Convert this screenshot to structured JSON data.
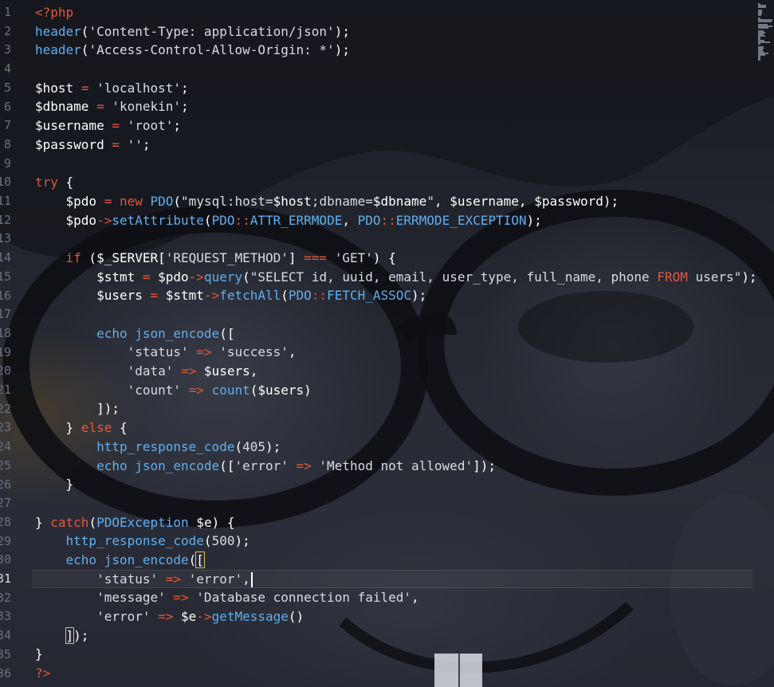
{
  "editor": {
    "active_line": 31,
    "lines": [
      {
        "n": "1",
        "tokens": [
          {
            "t": "<?php",
            "c": "tok-php"
          }
        ]
      },
      {
        "n": "2",
        "tokens": [
          {
            "t": "header",
            "c": "tok-fn"
          },
          {
            "t": "(",
            "c": "tok-punct"
          },
          {
            "t": "'Content-Type: application/json'",
            "c": "tok-str"
          },
          {
            "t": ");",
            "c": "tok-punct"
          }
        ]
      },
      {
        "n": "3",
        "tokens": [
          {
            "t": "header",
            "c": "tok-fn"
          },
          {
            "t": "(",
            "c": "tok-punct"
          },
          {
            "t": "'Access-Control-Allow-Origin: *'",
            "c": "tok-str"
          },
          {
            "t": ");",
            "c": "tok-punct"
          }
        ]
      },
      {
        "n": "4",
        "tokens": []
      },
      {
        "n": "5",
        "tokens": [
          {
            "t": "$host",
            "c": "tok-var"
          },
          {
            "t": " = ",
            "c": "tok-op"
          },
          {
            "t": "'localhost'",
            "c": "tok-str"
          },
          {
            "t": ";",
            "c": "tok-punct"
          }
        ]
      },
      {
        "n": "6",
        "tokens": [
          {
            "t": "$dbname",
            "c": "tok-var"
          },
          {
            "t": " = ",
            "c": "tok-op"
          },
          {
            "t": "'konekin'",
            "c": "tok-str"
          },
          {
            "t": ";",
            "c": "tok-punct"
          }
        ]
      },
      {
        "n": "7",
        "tokens": [
          {
            "t": "$username",
            "c": "tok-var"
          },
          {
            "t": " = ",
            "c": "tok-op"
          },
          {
            "t": "'root'",
            "c": "tok-str"
          },
          {
            "t": ";",
            "c": "tok-punct"
          }
        ]
      },
      {
        "n": "8",
        "tokens": [
          {
            "t": "$password",
            "c": "tok-var"
          },
          {
            "t": " = ",
            "c": "tok-op"
          },
          {
            "t": "''",
            "c": "tok-str"
          },
          {
            "t": ";",
            "c": "tok-punct"
          }
        ]
      },
      {
        "n": "9",
        "tokens": []
      },
      {
        "n": "10",
        "tokens": [
          {
            "t": "try",
            "c": "tok-kw"
          },
          {
            "t": " {",
            "c": "tok-punct"
          }
        ]
      },
      {
        "n": "11",
        "tokens": [
          {
            "t": "    $pdo",
            "c": "tok-var"
          },
          {
            "t": " = ",
            "c": "tok-op"
          },
          {
            "t": "new",
            "c": "tok-kw"
          },
          {
            "t": " PDO",
            "c": "tok-cls"
          },
          {
            "t": "(",
            "c": "tok-punct"
          },
          {
            "t": "\"mysql:host=",
            "c": "tok-str"
          },
          {
            "t": "$host",
            "c": "tok-var"
          },
          {
            "t": ";dbname=",
            "c": "tok-str"
          },
          {
            "t": "$dbname",
            "c": "tok-var"
          },
          {
            "t": "\"",
            "c": "tok-str"
          },
          {
            "t": ", ",
            "c": "tok-punct"
          },
          {
            "t": "$username",
            "c": "tok-var"
          },
          {
            "t": ", ",
            "c": "tok-punct"
          },
          {
            "t": "$password",
            "c": "tok-var"
          },
          {
            "t": ");",
            "c": "tok-punct"
          }
        ]
      },
      {
        "n": "12",
        "tokens": [
          {
            "t": "    $pdo",
            "c": "tok-var"
          },
          {
            "t": "->",
            "c": "tok-op"
          },
          {
            "t": "setAttribute",
            "c": "tok-fn"
          },
          {
            "t": "(",
            "c": "tok-punct"
          },
          {
            "t": "PDO",
            "c": "tok-cls"
          },
          {
            "t": "::",
            "c": "tok-op"
          },
          {
            "t": "ATTR_ERRMODE",
            "c": "tok-cls"
          },
          {
            "t": ", ",
            "c": "tok-punct"
          },
          {
            "t": "PDO",
            "c": "tok-cls"
          },
          {
            "t": "::",
            "c": "tok-op"
          },
          {
            "t": "ERRMODE_EXCEPTION",
            "c": "tok-cls"
          },
          {
            "t": ");",
            "c": "tok-punct"
          }
        ]
      },
      {
        "n": "13",
        "tokens": []
      },
      {
        "n": "14",
        "tokens": [
          {
            "t": "    if",
            "c": "tok-kw"
          },
          {
            "t": " (",
            "c": "tok-punct"
          },
          {
            "t": "$_SERVER",
            "c": "tok-var"
          },
          {
            "t": "[",
            "c": "tok-punct"
          },
          {
            "t": "'REQUEST_METHOD'",
            "c": "tok-str"
          },
          {
            "t": "] ",
            "c": "tok-punct"
          },
          {
            "t": "===",
            "c": "tok-op"
          },
          {
            "t": " 'GET'",
            "c": "tok-str"
          },
          {
            "t": ") {",
            "c": "tok-punct"
          }
        ]
      },
      {
        "n": "15",
        "tokens": [
          {
            "t": "        $stmt",
            "c": "tok-var"
          },
          {
            "t": " = ",
            "c": "tok-op"
          },
          {
            "t": "$pdo",
            "c": "tok-var"
          },
          {
            "t": "->",
            "c": "tok-op"
          },
          {
            "t": "query",
            "c": "tok-fn"
          },
          {
            "t": "(",
            "c": "tok-punct"
          },
          {
            "t": "\"SELECT id, uuid, email, user_type, full_name, phone ",
            "c": "tok-str"
          },
          {
            "t": "FROM",
            "c": "tok-kw"
          },
          {
            "t": " users\"",
            "c": "tok-str"
          },
          {
            "t": ");",
            "c": "tok-punct"
          }
        ]
      },
      {
        "n": "16",
        "tokens": [
          {
            "t": "        $users",
            "c": "tok-var"
          },
          {
            "t": " = ",
            "c": "tok-op"
          },
          {
            "t": "$stmt",
            "c": "tok-var"
          },
          {
            "t": "->",
            "c": "tok-op"
          },
          {
            "t": "fetchAll",
            "c": "tok-fn"
          },
          {
            "t": "(",
            "c": "tok-punct"
          },
          {
            "t": "PDO",
            "c": "tok-cls"
          },
          {
            "t": "::",
            "c": "tok-op"
          },
          {
            "t": "FETCH_ASSOC",
            "c": "tok-cls"
          },
          {
            "t": ");",
            "c": "tok-punct"
          }
        ]
      },
      {
        "n": "17",
        "tokens": []
      },
      {
        "n": "18",
        "tokens": [
          {
            "t": "        echo",
            "c": "tok-fn"
          },
          {
            "t": " json_encode",
            "c": "tok-fn"
          },
          {
            "t": "([",
            "c": "tok-punct"
          }
        ]
      },
      {
        "n": "19",
        "tokens": [
          {
            "t": "            'status'",
            "c": "tok-str"
          },
          {
            "t": " => ",
            "c": "tok-op"
          },
          {
            "t": "'success'",
            "c": "tok-str"
          },
          {
            "t": ",",
            "c": "tok-punct"
          }
        ]
      },
      {
        "n": "20",
        "tokens": [
          {
            "t": "            'data'",
            "c": "tok-str"
          },
          {
            "t": " => ",
            "c": "tok-op"
          },
          {
            "t": "$users",
            "c": "tok-var"
          },
          {
            "t": ",",
            "c": "tok-punct"
          }
        ]
      },
      {
        "n": "21",
        "tokens": [
          {
            "t": "            'count'",
            "c": "tok-str"
          },
          {
            "t": " => ",
            "c": "tok-op"
          },
          {
            "t": "count",
            "c": "tok-fn"
          },
          {
            "t": "(",
            "c": "tok-punct"
          },
          {
            "t": "$users",
            "c": "tok-var"
          },
          {
            "t": ")",
            "c": "tok-punct"
          }
        ]
      },
      {
        "n": "22",
        "tokens": [
          {
            "t": "        ]);",
            "c": "tok-punct"
          }
        ]
      },
      {
        "n": "23",
        "tokens": [
          {
            "t": "    }",
            "c": "tok-punct"
          },
          {
            "t": " else",
            "c": "tok-kw"
          },
          {
            "t": " {",
            "c": "tok-punct"
          }
        ]
      },
      {
        "n": "24",
        "tokens": [
          {
            "t": "        http_response_code",
            "c": "tok-fn"
          },
          {
            "t": "(",
            "c": "tok-punct"
          },
          {
            "t": "405",
            "c": "tok-str"
          },
          {
            "t": ");",
            "c": "tok-punct"
          }
        ]
      },
      {
        "n": "25",
        "tokens": [
          {
            "t": "        echo",
            "c": "tok-fn"
          },
          {
            "t": " json_encode",
            "c": "tok-fn"
          },
          {
            "t": "([",
            "c": "tok-punct"
          },
          {
            "t": "'error'",
            "c": "tok-str"
          },
          {
            "t": " => ",
            "c": "tok-op"
          },
          {
            "t": "'Method not allowed'",
            "c": "tok-str"
          },
          {
            "t": "]);",
            "c": "tok-punct"
          }
        ]
      },
      {
        "n": "26",
        "tokens": [
          {
            "t": "    }",
            "c": "tok-punct"
          }
        ]
      },
      {
        "n": "27",
        "tokens": []
      },
      {
        "n": "28",
        "tokens": [
          {
            "t": "}",
            "c": "tok-punct"
          },
          {
            "t": " catch",
            "c": "tok-kw"
          },
          {
            "t": "(",
            "c": "tok-punct"
          },
          {
            "t": "PDOException",
            "c": "tok-cls"
          },
          {
            "t": " $e",
            "c": "tok-var"
          },
          {
            "t": ") {",
            "c": "tok-punct"
          }
        ]
      },
      {
        "n": "29",
        "tokens": [
          {
            "t": "    http_response_code",
            "c": "tok-fn"
          },
          {
            "t": "(",
            "c": "tok-punct"
          },
          {
            "t": "500",
            "c": "tok-str"
          },
          {
            "t": ");",
            "c": "tok-punct"
          }
        ]
      },
      {
        "n": "30",
        "tokens": [
          {
            "t": "    echo",
            "c": "tok-fn"
          },
          {
            "t": " json_encode",
            "c": "tok-fn"
          },
          {
            "t": "(",
            "c": "tok-punct"
          },
          {
            "t": "[",
            "c": "tok-punct tok-bracket-match"
          }
        ]
      },
      {
        "n": "31",
        "tokens": [
          {
            "t": "        'status'",
            "c": "tok-str"
          },
          {
            "t": " => ",
            "c": "tok-op"
          },
          {
            "t": "'error'",
            "c": "tok-str"
          },
          {
            "t": ",",
            "c": "tok-punct"
          }
        ],
        "cursor": true
      },
      {
        "n": "32",
        "tokens": [
          {
            "t": "        'message'",
            "c": "tok-str"
          },
          {
            "t": " => ",
            "c": "tok-op"
          },
          {
            "t": "'Database connection failed'",
            "c": "tok-str"
          },
          {
            "t": ",",
            "c": "tok-punct"
          }
        ]
      },
      {
        "n": "33",
        "tokens": [
          {
            "t": "        'error'",
            "c": "tok-str"
          },
          {
            "t": " => ",
            "c": "tok-op"
          },
          {
            "t": "$e",
            "c": "tok-var"
          },
          {
            "t": "->",
            "c": "tok-op"
          },
          {
            "t": "getMessage",
            "c": "tok-fn"
          },
          {
            "t": "()",
            "c": "tok-punct"
          }
        ]
      },
      {
        "n": "34",
        "tokens": [
          {
            "t": "    ",
            "c": "tok-punct"
          },
          {
            "t": "]",
            "c": "tok-punct tok-bracket-match"
          },
          {
            "t": ");",
            "c": "tok-punct"
          }
        ]
      },
      {
        "n": "35",
        "tokens": [
          {
            "t": "}",
            "c": "tok-punct"
          }
        ]
      },
      {
        "n": "36",
        "tokens": [
          {
            "t": "?>",
            "c": "tok-php"
          }
        ]
      }
    ]
  },
  "colors": {
    "keyword": "#e0583c",
    "function": "#61aeee",
    "string": "#d9dbe3",
    "variable": "#ffffff",
    "line_number": "#6b7080"
  }
}
